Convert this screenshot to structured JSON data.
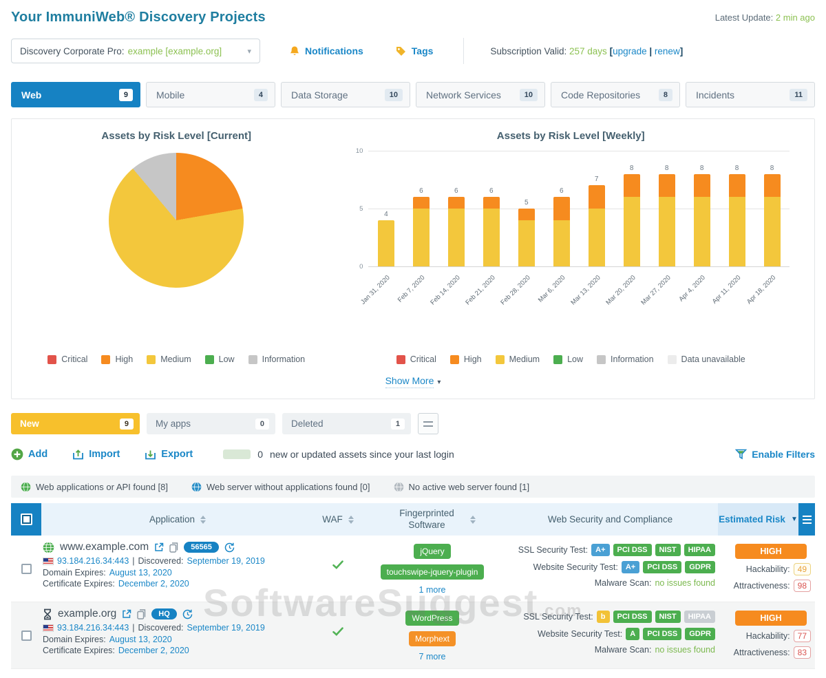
{
  "header": {
    "title": "Your ImmuniWeb® Discovery Projects",
    "latest_update_label": "Latest Update:",
    "latest_update_value": "2 min ago"
  },
  "controls": {
    "project_label": "Discovery Corporate Pro:",
    "project_value": "example [example.org]",
    "notifications_label": "Notifications",
    "tags_label": "Tags",
    "subscription_label": "Subscription Valid:",
    "subscription_value": "257 days",
    "bracket_open": "[",
    "upgrade_label": "upgrade",
    "separator": "|",
    "renew_label": "renew",
    "bracket_close": "]"
  },
  "tabs": [
    {
      "label": "Web",
      "count": "9",
      "active": true
    },
    {
      "label": "Mobile",
      "count": "4",
      "active": false
    },
    {
      "label": "Data Storage",
      "count": "10",
      "active": false
    },
    {
      "label": "Network Services",
      "count": "10",
      "active": false
    },
    {
      "label": "Code Repositories",
      "count": "8",
      "active": false
    },
    {
      "label": "Incidents",
      "count": "11",
      "active": false
    }
  ],
  "charts": {
    "show_more": "Show More"
  },
  "chart_data": [
    {
      "type": "pie",
      "title": "Assets by Risk Level [Current]",
      "labels": [
        "Critical",
        "High",
        "Medium",
        "Low",
        "Information"
      ],
      "values": [
        0,
        2,
        6,
        0,
        1
      ],
      "colors": [
        "#e2534a",
        "#f68b1f",
        "#f3c73c",
        "#4cae4f",
        "#c6c6c6"
      ],
      "legend_position": "bottom"
    },
    {
      "type": "bar",
      "stacked": true,
      "title": "Assets by Risk Level [Weekly]",
      "categories": [
        "Jan 31, 2020",
        "Feb 7, 2020",
        "Feb 14, 2020",
        "Feb 21, 2020",
        "Feb 28, 2020",
        "Mar 6, 2020",
        "Mar 13, 2020",
        "Mar 20, 2020",
        "Mar 27, 2020",
        "Apr 4, 2020",
        "Apr 11, 2020",
        "Apr 18, 2020"
      ],
      "series": [
        {
          "name": "Medium",
          "color": "#f3c73c",
          "values": [
            4,
            5,
            5,
            5,
            4,
            4,
            5,
            6,
            6,
            6,
            6,
            6
          ]
        },
        {
          "name": "High",
          "color": "#f68b1f",
          "values": [
            0,
            1,
            1,
            1,
            1,
            2,
            2,
            2,
            2,
            2,
            2,
            2
          ]
        }
      ],
      "totals": [
        4,
        6,
        6,
        6,
        5,
        6,
        7,
        8,
        8,
        8,
        8,
        8
      ],
      "ylim": [
        0,
        10
      ],
      "yticks": [
        0,
        5,
        10
      ],
      "grid": true,
      "legend_position": "bottom",
      "legend_items": [
        {
          "label": "Critical",
          "color": "#e2534a"
        },
        {
          "label": "High",
          "color": "#f68b1f"
        },
        {
          "label": "Medium",
          "color": "#f3c73c"
        },
        {
          "label": "Low",
          "color": "#4cae4f"
        },
        {
          "label": "Information",
          "color": "#c6c6c6"
        },
        {
          "label": "Data unavailable",
          "color": "#ececec"
        }
      ]
    }
  ],
  "subtabs": [
    {
      "label": "New",
      "count": "9",
      "active": true
    },
    {
      "label": "My apps",
      "count": "0",
      "active": false
    },
    {
      "label": "Deleted",
      "count": "1",
      "active": false
    }
  ],
  "actions": {
    "add_label": "Add",
    "import_label": "Import",
    "export_label": "Export",
    "updates_count": "0",
    "updates_text": "new or updated assets since your last login",
    "enable_filters_label": "Enable Filters"
  },
  "filters": [
    {
      "label": "Web applications or API found [8]",
      "color": "green"
    },
    {
      "label": "Web server without applications found [0]",
      "color": "blue"
    },
    {
      "label": "No active web server found [1]",
      "color": "gray"
    }
  ],
  "table": {
    "headers": {
      "application": "Application",
      "waf": "WAF",
      "software": "Fingerprinted Software",
      "security": "Web Security and Compliance",
      "risk": "Estimated Risk"
    },
    "rows": [
      {
        "icon": "globe",
        "name": "www.example.com",
        "badge": "56565",
        "ip": "93.184.216.34:443",
        "pipe": "|",
        "discovered_label": "Discovered:",
        "discovered": "September 19, 2019",
        "domain_label": "Domain Expires:",
        "domain_expires": "August 13, 2020",
        "cert_label": "Certificate Expires:",
        "cert_expires": "December 2, 2020",
        "waf": true,
        "software": [
          {
            "label": "jQuery",
            "style": "green"
          },
          {
            "label": "touchswipe-jquery-plugin",
            "style": "green"
          }
        ],
        "more": "1 more",
        "ssl_label": "SSL Security Test:",
        "ssl_badges": [
          {
            "label": "A+",
            "style": "blue"
          },
          {
            "label": "PCI DSS",
            "style": "green"
          },
          {
            "label": "NIST",
            "style": "green"
          },
          {
            "label": "HIPAA",
            "style": "green"
          }
        ],
        "web_label": "Website Security Test:",
        "web_badges": [
          {
            "label": "A+",
            "style": "blue"
          },
          {
            "label": "PCI DSS",
            "style": "green"
          },
          {
            "label": "GDPR",
            "style": "green"
          }
        ],
        "malware_label": "Malware Scan:",
        "malware_value": "no issues found",
        "risk": "HIGH",
        "hackability_label": "Hackability:",
        "hackability": "49",
        "hackability_style": "yellow",
        "attractiveness_label": "Attractiveness:",
        "attractiveness": "98",
        "attractiveness_style": "red"
      },
      {
        "icon": "hourglass",
        "name": "example.org",
        "badge": "HQ",
        "ip": "93.184.216.34:443",
        "pipe": "|",
        "discovered_label": "Discovered:",
        "discovered": "September 19, 2019",
        "domain_label": "Domain Expires:",
        "domain_expires": "August 13, 2020",
        "cert_label": "Certificate Expires:",
        "cert_expires": "December 2, 2020",
        "waf": true,
        "software": [
          {
            "label": "WordPress",
            "style": "green"
          },
          {
            "label": "Morphext",
            "style": "orange"
          }
        ],
        "more": "7 more",
        "ssl_label": "SSL Security Test:",
        "ssl_badges": [
          {
            "label": "b",
            "style": "yellow"
          },
          {
            "label": "PCI DSS",
            "style": "green"
          },
          {
            "label": "NIST",
            "style": "green"
          },
          {
            "label": "HIPAA",
            "style": "gray"
          }
        ],
        "web_label": "Website Security Test:",
        "web_badges": [
          {
            "label": "A",
            "style": "green"
          },
          {
            "label": "PCI DSS",
            "style": "green"
          },
          {
            "label": "GDPR",
            "style": "green"
          }
        ],
        "malware_label": "Malware Scan:",
        "malware_value": "no issues found",
        "risk": "HIGH",
        "hackability_label": "Hackability:",
        "hackability": "77",
        "hackability_style": "red",
        "attractiveness_label": "Attractiveness:",
        "attractiveness": "83",
        "attractiveness_style": "red"
      }
    ]
  },
  "watermark": {
    "text": "SoftwareSuggest",
    "suffix": ".com"
  }
}
